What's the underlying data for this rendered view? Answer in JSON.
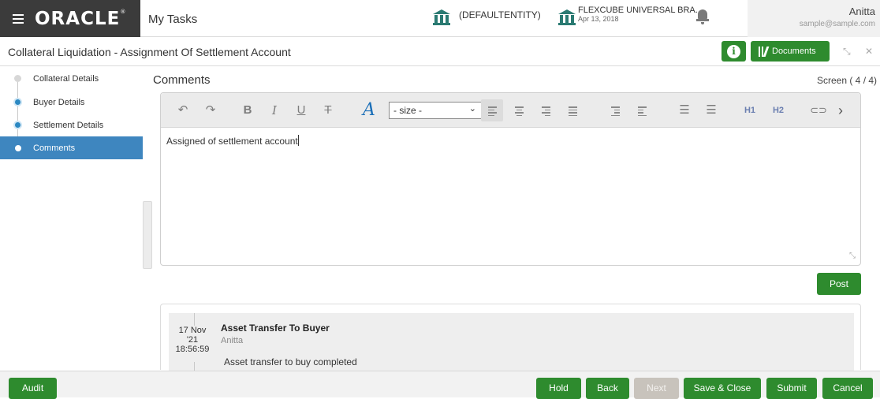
{
  "header": {
    "brand": "ORACLE",
    "module": "My Tasks",
    "entity": "(DEFAULTENTITY)",
    "app_name": "FLEXCUBE UNIVERSAL BRA...",
    "app_date": "Apr 13, 2018",
    "user_name": "Anitta",
    "user_email": "sample@sample.com"
  },
  "titlebar": {
    "title": "Collateral Liquidation - Assignment Of Settlement Account",
    "info_icon": "i",
    "documents_label": "Documents"
  },
  "nav": {
    "items": [
      {
        "label": "Collateral Details",
        "state": "pending"
      },
      {
        "label": "Buyer Details",
        "state": "visited"
      },
      {
        "label": "Settlement Details",
        "state": "visited"
      },
      {
        "label": "Comments",
        "state": "active"
      }
    ]
  },
  "main": {
    "heading": "Comments",
    "screen_indicator": "Screen ( 4 / 4)"
  },
  "editor": {
    "size_select": "- size -",
    "h1": "H1",
    "h2": "H2",
    "content": "Assigned of settlement account"
  },
  "post_label": "Post",
  "comment": {
    "date_line1": "17 Nov",
    "date_line2": "'21",
    "time": "18:56:59",
    "title": "Asset Transfer To Buyer",
    "user": "Anitta",
    "body": "Asset transfer to buy completed"
  },
  "footer": {
    "audit": "Audit",
    "hold": "Hold",
    "back": "Back",
    "next": "Next",
    "save_close": "Save & Close",
    "submit": "Submit",
    "cancel": "Cancel"
  },
  "colors": {
    "primary_green": "#2e8b2e",
    "nav_active": "#3e86bf",
    "brand_bar": "#3b3b3b",
    "disabled_button": "#c8c3bc"
  }
}
